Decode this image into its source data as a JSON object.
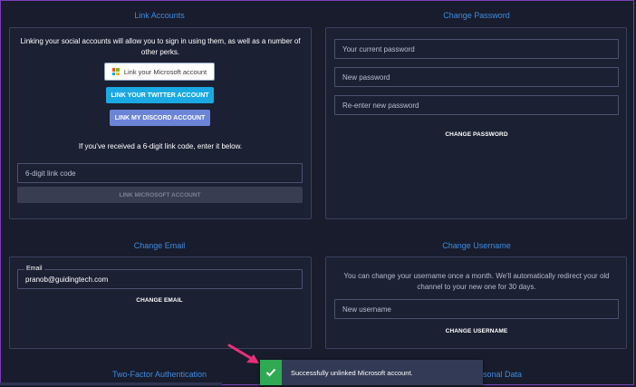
{
  "link_accounts": {
    "title": "Link Accounts",
    "description": "Linking your social accounts will allow you to sign in using them, as well as a number of other perks.",
    "microsoft_button": "Link your Microsoft account",
    "twitter_button": "LINK YOUR TWITTER ACCOUNT",
    "discord_button": "LINK MY DISCORD ACCOUNT",
    "code_prompt": "If you've received a 6-digit link code, enter it below.",
    "code_placeholder": "6-digit link code",
    "link_microsoft_button": "LINK MICROSOFT ACCOUNT"
  },
  "change_password": {
    "title": "Change Password",
    "current_placeholder": "Your current password",
    "new_placeholder": "New password",
    "reenter_placeholder": "Re-enter new password",
    "submit": "CHANGE PASSWORD"
  },
  "change_email": {
    "title": "Change Email",
    "field_label": "Email",
    "field_value": "pranob@guidingtech.com",
    "submit": "CHANGE EMAIL"
  },
  "change_username": {
    "title": "Change Username",
    "description": "You can change your username once a month. We'll automatically redirect your old channel to your new one for 30 days.",
    "new_placeholder": "New username",
    "submit": "CHANGE USERNAME"
  },
  "two_factor": {
    "title": "Two-Factor Authentication"
  },
  "personal_data": {
    "title_partial": "rsonal Data"
  },
  "toast": {
    "message": "Successfully unlinked Microsoft account."
  },
  "colors": {
    "background": "#181c2c",
    "accent_blue": "#3f8ce0",
    "twitter": "#1aa9e2",
    "discord": "#6c84d8",
    "success": "#2faa52",
    "annotation_arrow": "#e8307a"
  },
  "icons": [
    "microsoft-logo-icon",
    "checkmark-icon",
    "annotation-arrow-icon"
  ]
}
